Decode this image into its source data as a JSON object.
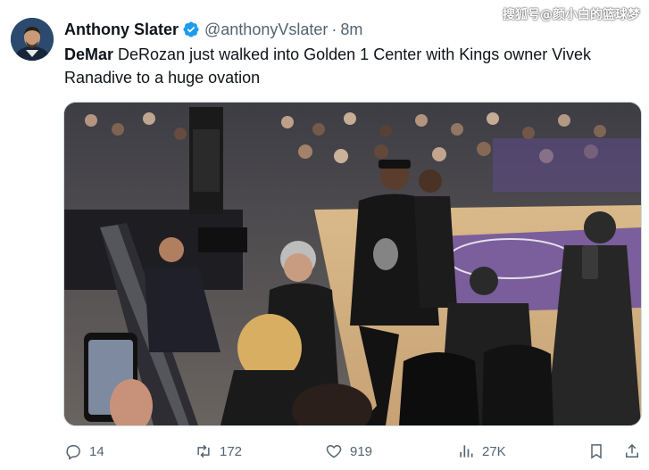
{
  "tweet": {
    "author_name": "Anthony Slater",
    "author_handle": "@anthonyVslater",
    "separator": "·",
    "time": "8m",
    "text_bold": "DeMar",
    "text_rest": " DeRozan just walked into Golden 1 Center with Kings owner Vivek Ranadive to a huge ovation"
  },
  "watermark": "搜狐号@颜小白的篮球梦",
  "actions": {
    "replies": "14",
    "retweets": "172",
    "likes": "919",
    "views": "27K"
  },
  "icons": {
    "verified": "verified-badge-icon",
    "reply": "reply-icon",
    "retweet": "retweet-icon",
    "like": "heart-icon",
    "views": "views-icon",
    "bookmark": "bookmark-icon",
    "share": "share-icon"
  },
  "colors": {
    "verified_blue": "#1d9bf0",
    "text_primary": "#0f1419",
    "text_secondary": "#536471",
    "court_purple": "#6b4fa0"
  }
}
